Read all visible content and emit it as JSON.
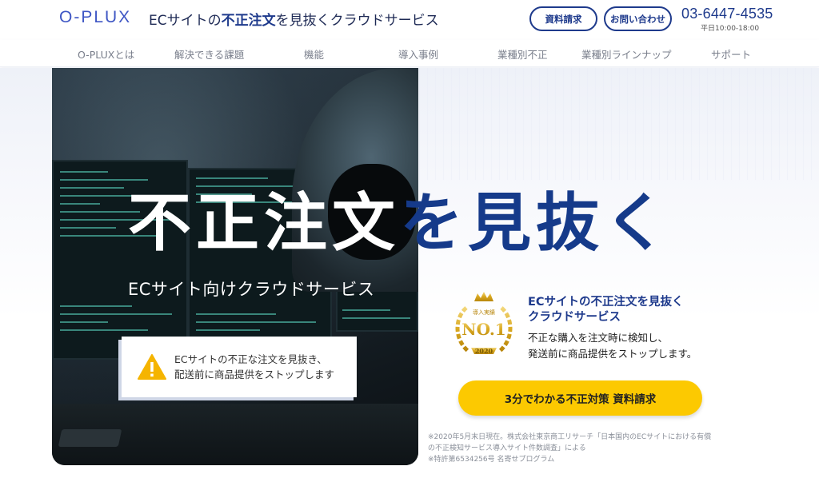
{
  "header": {
    "logo": "O-PLUX",
    "tagline_prefix": "ECサイトの",
    "tagline_strong": "不正注文",
    "tagline_suffix": "を見抜くクラウドサービス",
    "doc_button": "資料請求",
    "contact_button": "お問い合わせ",
    "phone": "03-6447-4535",
    "hours": "平日10:00-18:00"
  },
  "nav": {
    "items": [
      "O-PLUXとは",
      "解決できる課題",
      "機能",
      "導入事例",
      "業種別不正",
      "業種別ラインナップ",
      "サポート"
    ]
  },
  "hero": {
    "headline_white": "不正注文",
    "headline_blue": "を見抜く",
    "subhead": "ECサイト向けクラウドサービス",
    "warning_line1": "ECサイトの不正な注文を見抜き、",
    "warning_line2": "配送前に商品提供をストップします"
  },
  "award": {
    "badge_small": "導入実績",
    "badge_main": "NO.1",
    "badge_year": "2020",
    "title_line1": "ECサイトの不正注文を見抜く",
    "title_line2": "クラウドサービス",
    "desc_line1": "不正な購入を注文時に検知し、",
    "desc_line2": "発送前に商品提供をストップします。"
  },
  "cta": {
    "label": "3分でわかる不正対策 資料請求"
  },
  "footnote": {
    "line1": "※2020年5月末日現在。株式会社東京商工リサーチ「日本国内のECサイトにおける有償",
    "line2": "の不正検知サービス導入サイト件数調査」による",
    "line3": "※特許第6534256号 名寄せプログラム"
  },
  "colors": {
    "brand_blue": "#1e3a8c",
    "cta_yellow": "#fcc901",
    "warning_yellow": "#f5b400",
    "logo_blue": "#3e56c4"
  },
  "icons": [
    "warning-icon",
    "award-badge-icon"
  ]
}
